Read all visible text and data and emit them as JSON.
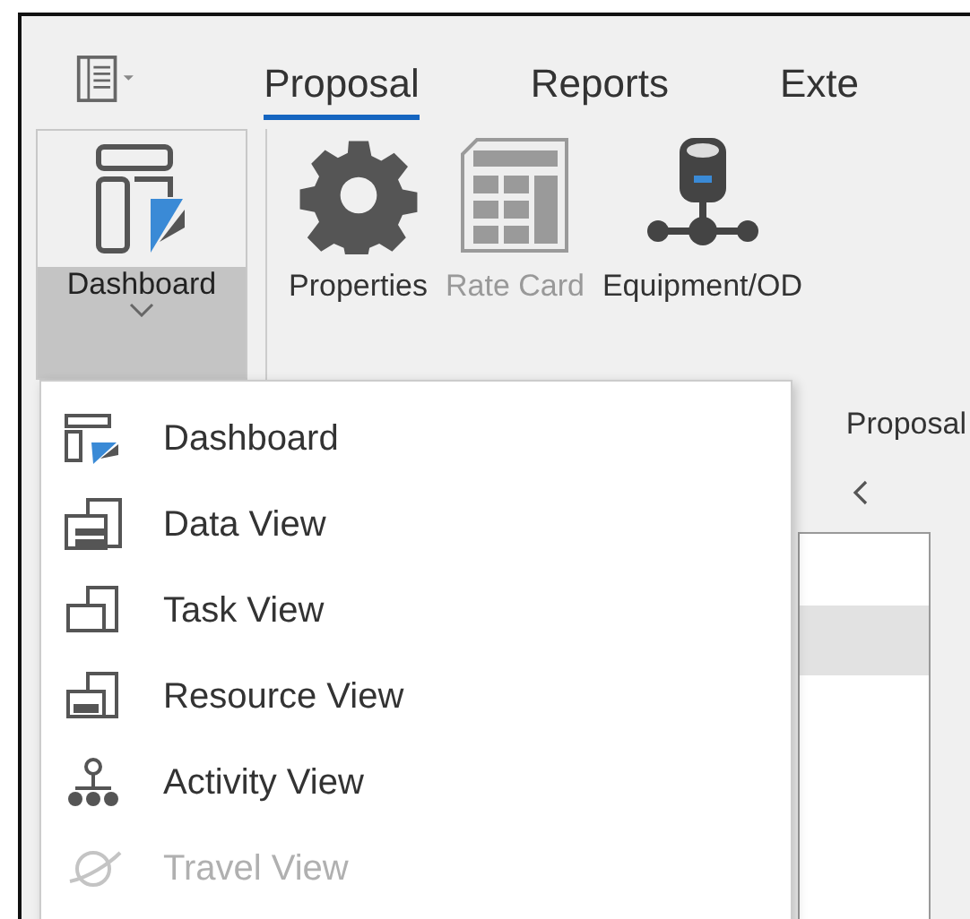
{
  "tabs": [
    {
      "label": "Proposal",
      "selected": true
    },
    {
      "label": "Reports",
      "selected": false
    },
    {
      "label": "Exte",
      "selected": false
    }
  ],
  "ribbon": {
    "buttons": [
      {
        "label": "Dashboard",
        "kind": "dashboard",
        "open": true,
        "disabled": false
      },
      {
        "label": "Properties",
        "kind": "gear",
        "disabled": false
      },
      {
        "label": "Rate Card",
        "kind": "calculator",
        "disabled": true
      },
      {
        "label": "Equipment/OD",
        "kind": "network",
        "disabled": false
      }
    ]
  },
  "document_tab": {
    "label": "Proposal"
  },
  "menu": {
    "items": [
      {
        "label": "Dashboard",
        "kind": "dashboard",
        "disabled": false
      },
      {
        "label": "Data View",
        "kind": "data",
        "disabled": false
      },
      {
        "label": "Task View",
        "kind": "task",
        "disabled": false
      },
      {
        "label": "Resource View",
        "kind": "resource",
        "disabled": false
      },
      {
        "label": "Activity View",
        "kind": "activity",
        "disabled": false
      },
      {
        "label": "Travel View",
        "kind": "travel",
        "disabled": true
      }
    ]
  }
}
